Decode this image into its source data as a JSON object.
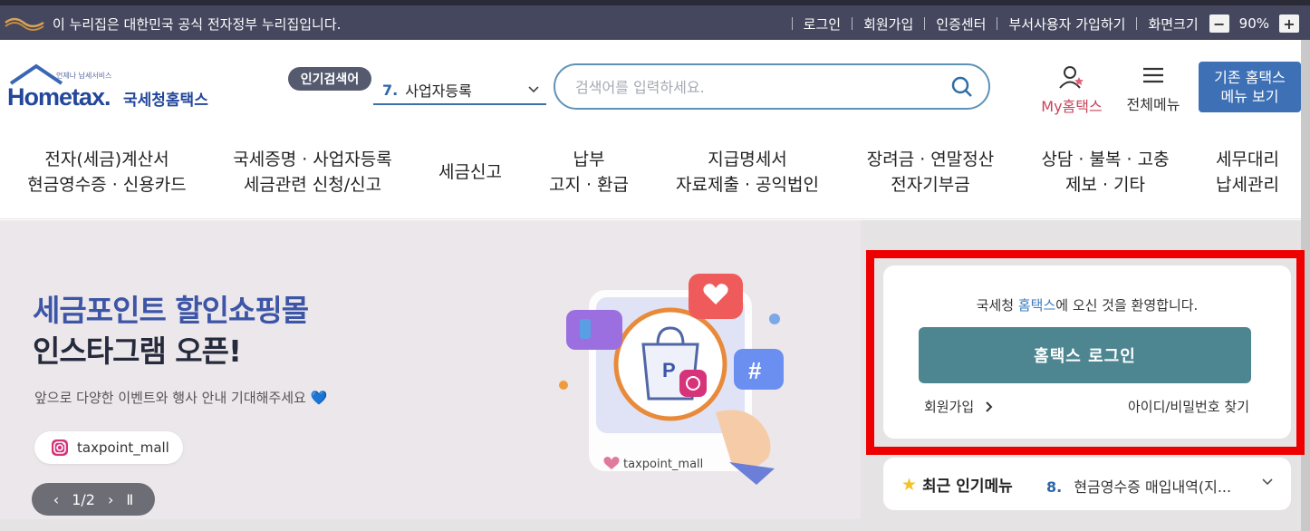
{
  "gov_bar": {
    "notice": "이 누리집은 대한민국 공식 전자정부 누리집입니다.",
    "links": [
      "로그인",
      "회원가입",
      "인증센터",
      "부서사용자 가입하기",
      "화면크기"
    ],
    "zoom_minus": "−",
    "zoom_value": "90%",
    "zoom_plus": "+"
  },
  "header": {
    "logo_small": "언제나 납세서비스",
    "logo_main": "Hometax.",
    "logo_korean": "국세청홈택스",
    "popular_label": "인기검색어",
    "popular_rank": "7.",
    "popular_term": "사업자등록",
    "search_placeholder": "검색어를 입력하세요.",
    "my_hometax": "My홈택스",
    "all_menu": "전체메뉴",
    "classic_line1": "기존 홈택스",
    "classic_line2": "메뉴 보기"
  },
  "nav": [
    {
      "line1": "전자(세금)계산서",
      "line2": "현금영수증 · 신용카드"
    },
    {
      "line1": "국세증명 · 사업자등록",
      "line2": "세금관련 신청/신고"
    },
    {
      "line1": "세금신고",
      "line2": ""
    },
    {
      "line1": "납부",
      "line2": "고지 · 환급"
    },
    {
      "line1": "지급명세서",
      "line2": "자료제출 · 공익법인"
    },
    {
      "line1": "장려금 · 연말정산",
      "line2": "전자기부금"
    },
    {
      "line1": "상담 · 불복 · 고충",
      "line2": "제보 · 기타"
    },
    {
      "line1": "세무대리",
      "line2": "납세관리"
    }
  ],
  "banner": {
    "title1": "세금포인트 할인쇼핑몰",
    "title2": "인스타그램 오픈!",
    "desc": "앞으로 다양한 이벤트와 행사 안내 기대해주세요 💙",
    "insta_handle": "taxpoint_mall",
    "card_handle": "taxpoint_mall",
    "pager": "1/2"
  },
  "login": {
    "welcome_prefix": "국세청 ",
    "welcome_highlight": "홈택스",
    "welcome_suffix": "에 오신 것을 환영합니다.",
    "login_button": "홈택스 로그인",
    "join": "회원가입",
    "find": "아이디/비밀번호 찾기"
  },
  "recent": {
    "title": "최근 인기메뉴",
    "rank": "8.",
    "item": "현금영수증 매입내역(지..."
  },
  "colors": {
    "gov_bar": "#44475e",
    "brand_blue": "#23479a",
    "login_button": "#4d8691",
    "highlight_frame": "#ee0000"
  }
}
